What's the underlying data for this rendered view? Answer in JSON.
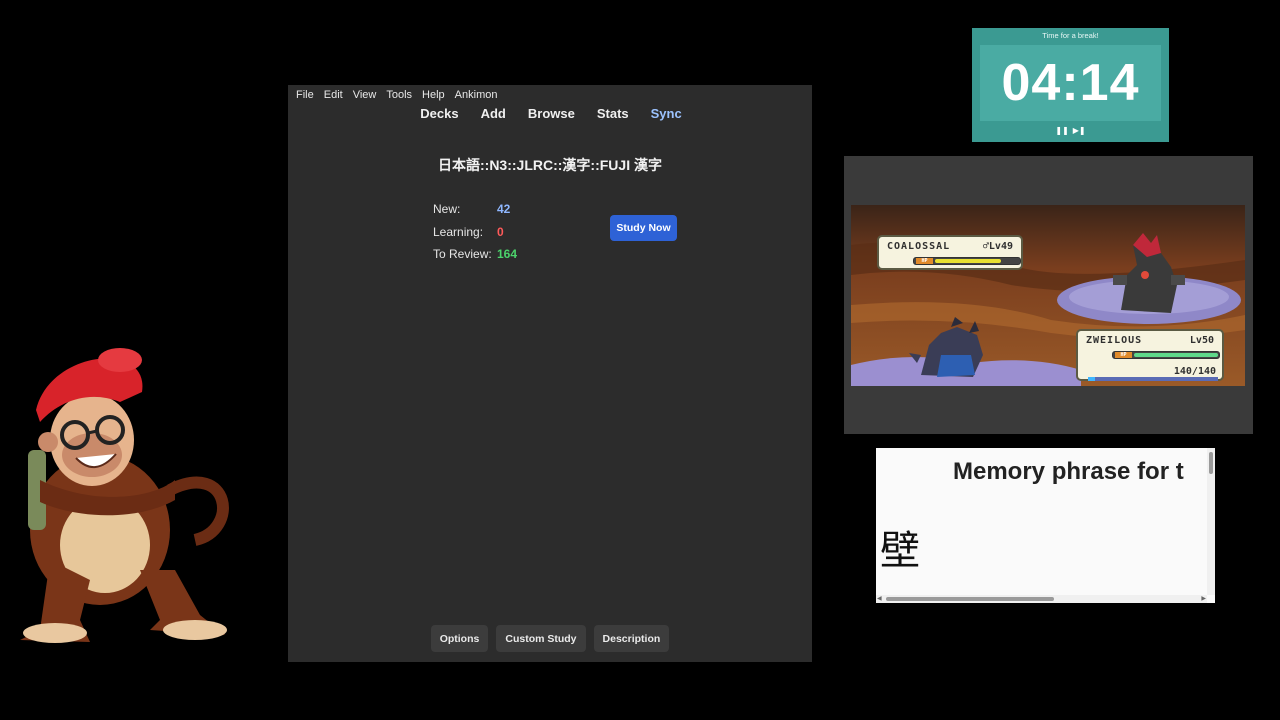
{
  "anki": {
    "menu": [
      "File",
      "Edit",
      "View",
      "Tools",
      "Help",
      "Ankimon"
    ],
    "toolbar": {
      "decks": "Decks",
      "add": "Add",
      "browse": "Browse",
      "stats": "Stats",
      "sync": "Sync"
    },
    "deck_title": "日本語::N3::JLRC::漢字::FUJI 漢字",
    "counts": {
      "new_label": "New:",
      "new_value": "42",
      "learning_label": "Learning:",
      "learning_value": "0",
      "review_label": "To Review:",
      "review_value": "164"
    },
    "study_now": "Study Now",
    "bottom": {
      "options": "Options",
      "custom_study": "Custom Study",
      "description": "Description"
    },
    "colors": {
      "new": "#8fb7ff",
      "learning": "#ff5a5a",
      "review": "#4bd36b",
      "study_button": "#2e62d6"
    }
  },
  "timer": {
    "caption": "Time for a break!",
    "time": "04:14",
    "pause_icon": "pause-icon",
    "skip_icon": "skip-icon"
  },
  "game": {
    "enemy": {
      "name": "COALOSSAL",
      "gender": "♂",
      "level": "Lv49",
      "hp_fraction": 0.78
    },
    "player": {
      "name": "ZWEILOUS",
      "level": "Lv50",
      "hp_current": "140",
      "hp_max": "140",
      "hp_fraction": 1.0,
      "exp_fraction": 0.05
    }
  },
  "card": {
    "heading": "Memory phrase for t",
    "kanji": "壁"
  }
}
